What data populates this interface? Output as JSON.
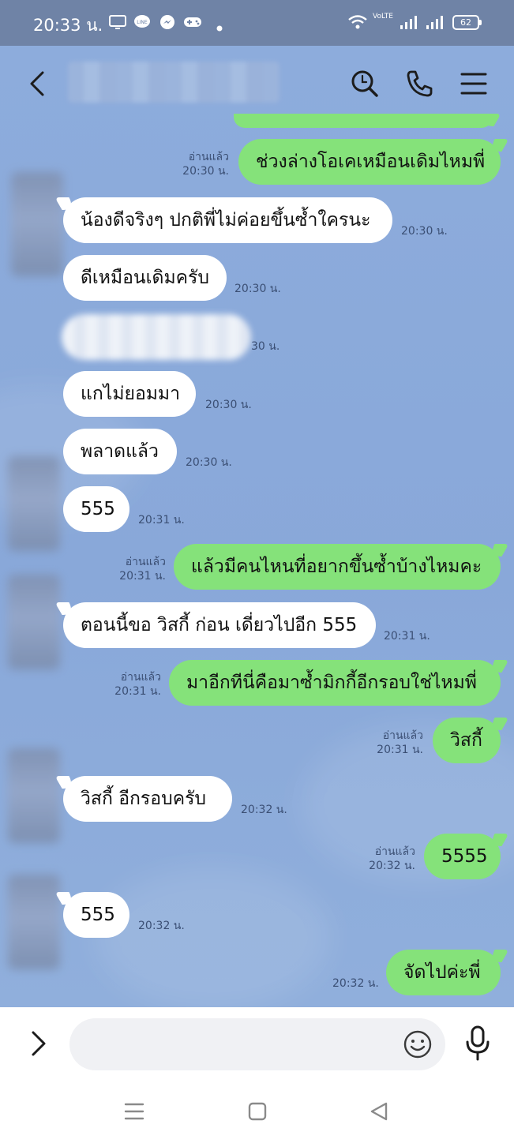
{
  "status_bar": {
    "time": "20:33 น.",
    "battery": "62",
    "icons": [
      "screen-icon",
      "line-app-icon",
      "messenger-icon",
      "game-controller-icon",
      "dot-icon",
      "wifi-icon",
      "volte-icon",
      "signal-icon",
      "signal-icon",
      "battery-icon"
    ],
    "volte_text": "VoLTE"
  },
  "header": {
    "back_icon": "chevron-left-icon",
    "search_icon": "search-icon",
    "call_icon": "phone-icon",
    "menu_icon": "menu-icon"
  },
  "messages": [
    {
      "dir": "out",
      "text": "ช่วงล่างโอเคเหมือนเดิมไหมพี่",
      "read": "อ่านแล้ว",
      "time": "20:30 น."
    },
    {
      "dir": "in",
      "text": "น้องดีจริงๆ ปกติพี่ไม่ค่อยขึ้นซ้ำใครนะ",
      "time": "20:30 น."
    },
    {
      "dir": "in",
      "text": "ดีเหมือนเดิมครับ",
      "time": "20:30 น."
    },
    {
      "dir": "in",
      "text": "",
      "time": "30 น."
    },
    {
      "dir": "in",
      "text": "แกไม่ยอมมา",
      "time": "20:30 น."
    },
    {
      "dir": "in",
      "text": "พลาดแล้ว",
      "time": "20:30 น."
    },
    {
      "dir": "in",
      "text": "555",
      "time": "20:31 น."
    },
    {
      "dir": "out",
      "text": "แล้วมีคนไหนที่อยากขึ้นซ้ำบ้างไหมคะ",
      "read": "อ่านแล้ว",
      "time": "20:31 น."
    },
    {
      "dir": "in",
      "text": "ตอนนี้ขอ วิสกี้ ก่อน เดี่ยวไปอีก 555",
      "time": "20:31 น."
    },
    {
      "dir": "out",
      "text": "มาอีกทีนี่คือมาซ้ำมิกกี้อีกรอบใช่ไหมพี่",
      "read": "อ่านแล้ว",
      "time": "20:31 น."
    },
    {
      "dir": "out",
      "text": "วิสกี้",
      "read": "อ่านแล้ว",
      "time": "20:31 น."
    },
    {
      "dir": "in",
      "text": "วิสกี้ อีกรอบครับ",
      "time": "20:32 น."
    },
    {
      "dir": "out",
      "text": "5555",
      "read": "อ่านแล้ว",
      "time": "20:32 น."
    },
    {
      "dir": "in",
      "text": "555",
      "time": "20:32 น."
    },
    {
      "dir": "out",
      "text": "จัดไปค่ะพี่",
      "time": "20:32 น."
    }
  ],
  "composer": {
    "expand_icon": "chevron-right-icon",
    "placeholder": "",
    "emoji_icon": "emoji-icon",
    "mic_icon": "microphone-icon"
  },
  "nav": {
    "recents_icon": "recents-icon",
    "home_icon": "home-icon",
    "back_icon": "back-triangle-icon"
  },
  "colors": {
    "status_bar": "#6f83a6",
    "chat_bg": "#8dacdc",
    "outgoing_bubble": "#85e27a",
    "incoming_bubble": "#ffffff"
  }
}
